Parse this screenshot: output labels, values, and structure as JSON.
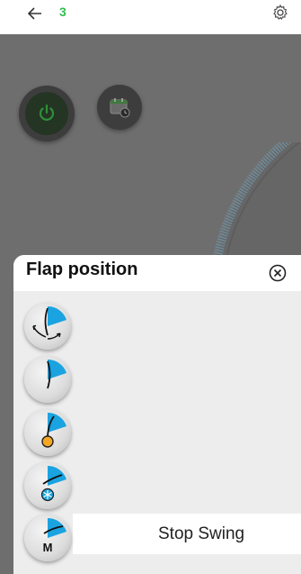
{
  "topbar": {
    "device_number": "3"
  },
  "panel": {
    "title": "Flap position",
    "items": [
      {
        "icon": "flap-swing-icon"
      },
      {
        "icon": "flap-position-icon"
      },
      {
        "icon": "flap-sun-icon"
      },
      {
        "icon": "flap-fan-icon"
      },
      {
        "icon": "flap-manual-icon",
        "label": "Stop Swing",
        "badge": "M"
      }
    ]
  },
  "colors": {
    "accent_blue": "#1aa3e0",
    "status_green": "#2fbf4e",
    "sun_orange": "#f5a623"
  }
}
